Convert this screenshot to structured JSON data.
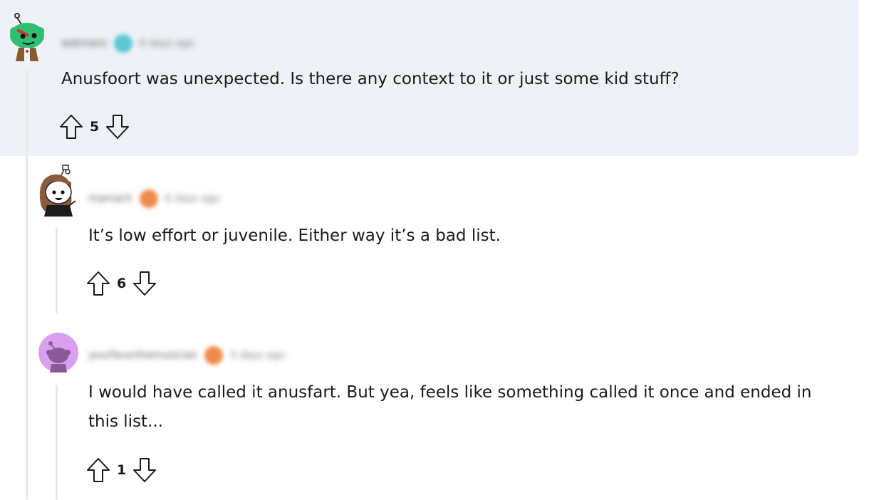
{
  "comments": [
    {
      "author": "watmans",
      "timestamp": "6 days ago",
      "flair_color": "#5bc8d3",
      "body": "Anusfoort was unexpected. Is there any context to it or just some kid stuff?",
      "score": "5"
    },
    {
      "author": "marnach",
      "timestamp": "6 days ago",
      "flair_color": "#f08a4b",
      "body": "It’s low effort or juvenile. Either way it’s a bad list.",
      "score": "6"
    },
    {
      "author": "yourfavorthemusician",
      "timestamp": "5 days ago",
      "flair_color": "#f08a4b",
      "body": "I would have called it anusfart. But yea, feels like something called it once and ended in this list...",
      "score": "1"
    }
  ],
  "icons": {
    "upvote": "arrow-up-outline",
    "downvote": "arrow-down-outline"
  }
}
